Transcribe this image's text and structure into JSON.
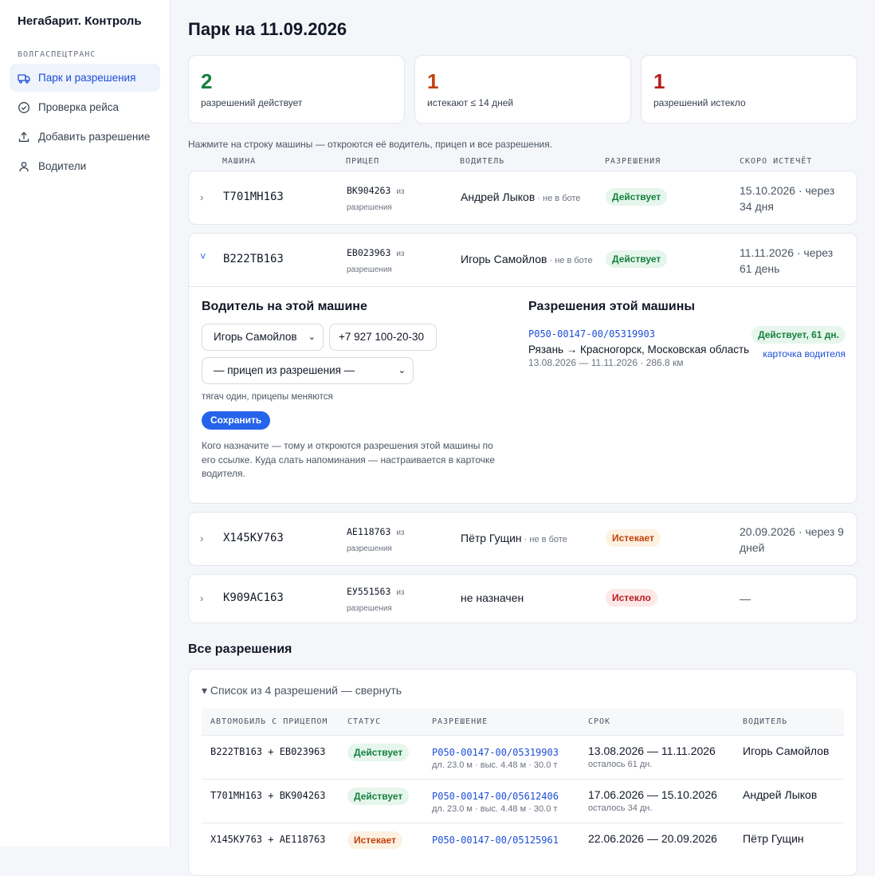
{
  "app": {
    "brand": "Негабарит. Контроль",
    "org": "ВОЛГАСПЕЦТРАНС"
  },
  "nav": [
    {
      "label": "Парк и разрешения",
      "icon": "truck-icon",
      "active": true
    },
    {
      "label": "Проверка рейса",
      "icon": "check-circle-icon",
      "active": false
    },
    {
      "label": "Добавить разрешение",
      "icon": "upload-icon",
      "active": false
    },
    {
      "label": "Водители",
      "icon": "user-icon",
      "active": false
    }
  ],
  "page": {
    "title": "Парк на 11.09.2026"
  },
  "stats": [
    {
      "value": "2",
      "label": "разрешений действует",
      "color": "#15803d"
    },
    {
      "value": "1",
      "label": "истекают ≤ 14 дней",
      "color": "#c2410c"
    },
    {
      "value": "1",
      "label": "разрешений истекло",
      "color": "#b91c1c"
    }
  ],
  "hint": "Нажмите на строку машины — откроются её водитель, прицеп и все разрешения.",
  "columns": {
    "vehicle": "МАШИНА",
    "trailer": "ПРИЦЕП",
    "driver": "ВОДИТЕЛЬ",
    "permits": "РАЗРЕШЕНИЯ",
    "expiring": "СКОРО ИСТЕЧЁТ"
  },
  "vehicles": [
    {
      "plate": "Т701МН163",
      "trailer": "ВК904263",
      "trailer_from": "из",
      "trailer_note": "разрешения",
      "driver": "Андрей Лыков",
      "driver_note": " · не в боте",
      "status": "Действует",
      "expires": "15.10.2026 · через 34 дня"
    },
    {
      "plate": "В222ТВ163",
      "trailer": "ЕВ023963",
      "trailer_from": "из",
      "trailer_note": "разрешения",
      "driver": "Игорь Самойлов",
      "driver_note": " · не в боте",
      "status": "Действует",
      "expires": "11.11.2026 · через 61 день"
    },
    {
      "plate": "Х145КУ763",
      "trailer": "АЕ118763",
      "trailer_from": "из",
      "trailer_note": "разрешения",
      "driver": "Пётр Гущин",
      "driver_note": " · не в боте",
      "status": "Истекает",
      "expires": "20.09.2026 · через 9 дней"
    },
    {
      "plate": "К909АС163",
      "trailer": "ЕУ551563",
      "trailer_from": "из",
      "trailer_note": "разрешения",
      "driver": "не назначен",
      "driver_note": "",
      "status": "Истекло",
      "expires": "—"
    }
  ],
  "expanded": {
    "driver_title": "Водитель на этой машине",
    "driver_select": "Игорь Самойлов",
    "phone": "+7 927 100-20-30",
    "trailer_select": "— прицеп из разрешения —",
    "note": "тягач один, прицепы меняются",
    "save": "Сохранить",
    "explain": "Кого назначите — тому и откроются разрешения этой машины по его ссылке. Куда слать напоминания — настраивается в карточке водителя.",
    "permits_title": "Разрешения этой машины",
    "permit_number": "P050-00147-00/05319903",
    "permit_status": "Действует, 61 дн.",
    "route": "Рязань → Красногорск, Московская область",
    "dates": "13.08.2026 — 11.11.2026 · 286.8 км",
    "driver_card_link": "карточка водителя"
  },
  "all_permits": {
    "title": "Все разрешения",
    "summary": "▾ Список из 4 разрешений — свернуть",
    "headers": [
      "АВТОМОБИЛЬ С ПРИЦЕПОМ",
      "СТАТУС",
      "РАЗРЕШЕНИЕ",
      "СРОК",
      "ВОДИТЕЛЬ"
    ],
    "rows": [
      {
        "vehicle": "В222ТВ163 + ЕВ023963",
        "status": "Действует",
        "permit": "P050-00147-00/05319903",
        "dims": "дл. 23.0 м · выс. 4.48 м · 30.0 т",
        "period": "13.08.2026 — 11.11.2026",
        "left": "осталось 61 дн.",
        "driver": "Игорь Самойлов"
      },
      {
        "vehicle": "Т701МН163 + ВК904263",
        "status": "Действует",
        "permit": "P050-00147-00/05612406",
        "dims": "дл. 23.0 м · выс. 4.48 м · 30.0 т",
        "period": "17.06.2026 — 15.10.2026",
        "left": "осталось 34 дн.",
        "driver": "Андрей Лыков"
      },
      {
        "vehicle": "Х145КУ763 + АЕ118763",
        "status": "Истекает",
        "permit": "P050-00147-00/05125961",
        "dims": "",
        "period": "22.06.2026 — 20.09.2026",
        "left": "",
        "driver": "Пётр Гущин"
      }
    ]
  }
}
